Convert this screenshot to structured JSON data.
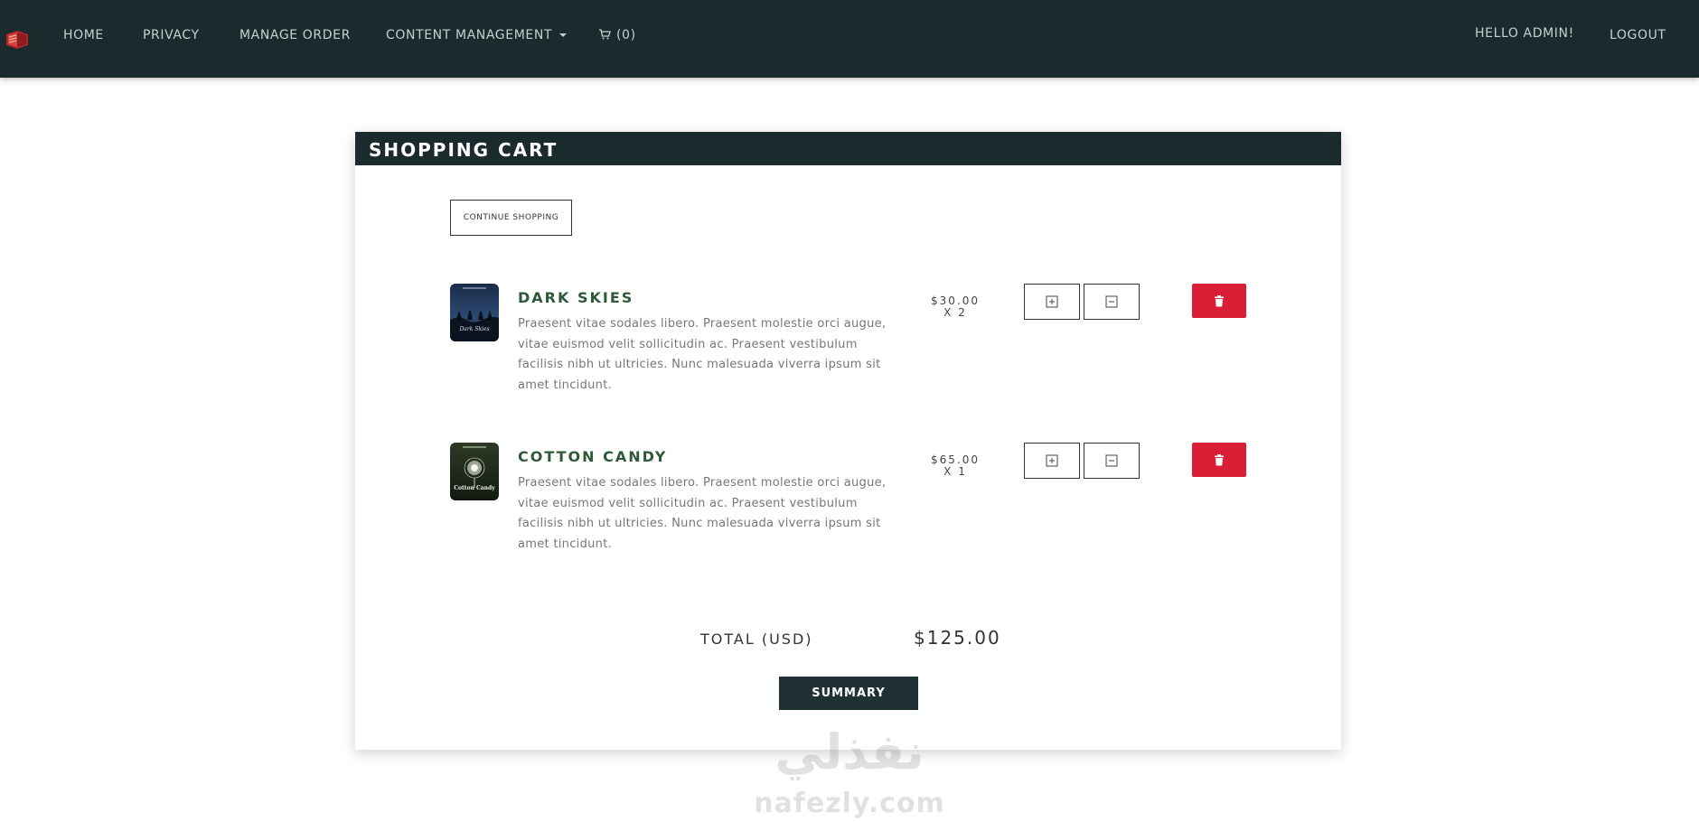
{
  "nav": {
    "home": "HOME",
    "privacy": "PRIVACY",
    "manage_order": "MANAGE ORDER",
    "content_management": "CONTENT MANAGEMENT",
    "cart": "(0)",
    "greeting": "HELLO ADMIN!",
    "logout": "LOGOUT"
  },
  "cart": {
    "title": "SHOPPING CART",
    "continue_label": "CONTINUE SHOPPING",
    "items": [
      {
        "title": "DARK SKIES",
        "description": "Praesent vitae sodales libero. Praesent molestie orci augue, vitae euismod velit sollicitudin ac. Praesent vestibulum facilisis nibh ut ultricies. Nunc malesuada viverra ipsum sit amet tincidunt.",
        "price": "$30.00",
        "quantity": "X 2",
        "cover_text": "Dark Skies"
      },
      {
        "title": "COTTON CANDY",
        "description": "Praesent vitae sodales libero. Praesent molestie orci augue, vitae euismod velit sollicitudin ac. Praesent vestibulum facilisis nibh ut ultricies. Nunc malesuada viverra ipsum sit amet tincidunt.",
        "price": "$65.00",
        "quantity": "X 1",
        "cover_text": "Cotton Candy"
      }
    ],
    "total_label": "TOTAL (USD)",
    "total_value": "$125.00",
    "summary_label": "SUMMARY"
  },
  "watermark": {
    "arabic": "نفذلي",
    "latin": "nafezly.com"
  },
  "colors": {
    "navbar": "#1b2a2c",
    "accent_green": "#2f5a3a",
    "delete_red": "#d91e36"
  },
  "icons": {
    "logo": "book-logo-icon",
    "cart": "cart-icon",
    "plus": "plus-square-icon",
    "minus": "minus-square-icon",
    "delete": "trash-icon"
  }
}
